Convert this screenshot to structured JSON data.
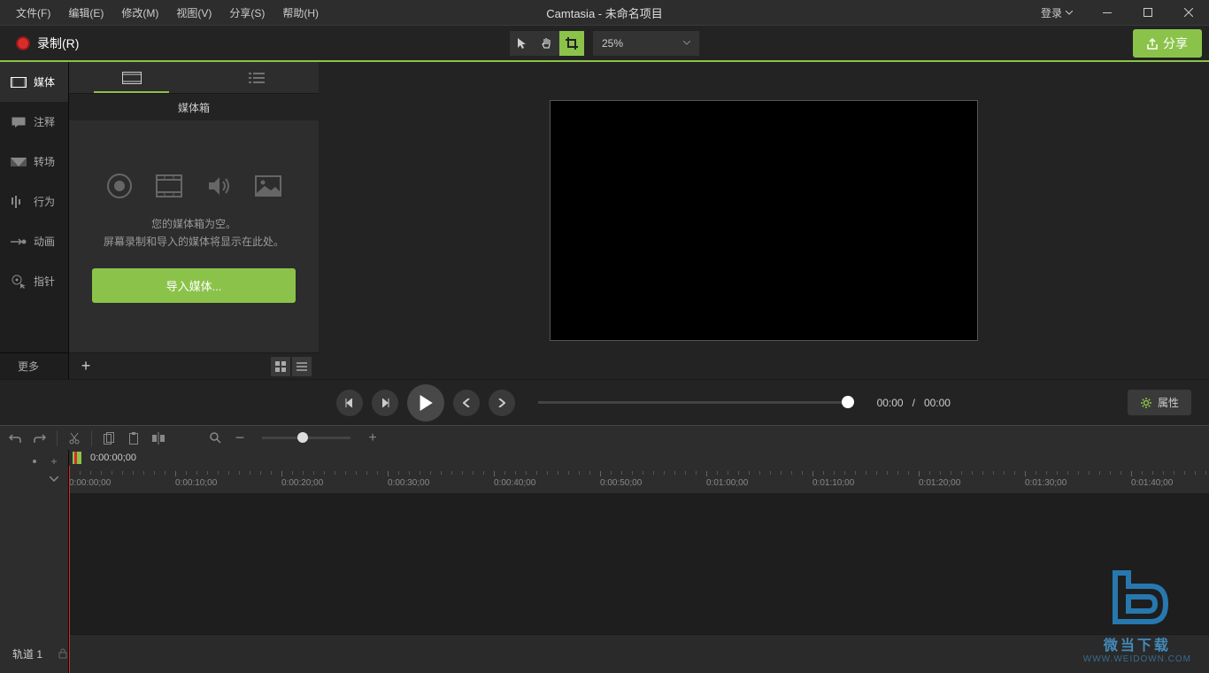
{
  "menubar": {
    "items": [
      "文件(F)",
      "编辑(E)",
      "修改(M)",
      "视图(V)",
      "分享(S)",
      "帮助(H)"
    ],
    "title": "Camtasia - 未命名项目",
    "login": "登录"
  },
  "toolbar": {
    "record": "录制(R)",
    "zoom": "25%",
    "share": "分享"
  },
  "sidebar": {
    "items": [
      {
        "label": "媒体"
      },
      {
        "label": "注释"
      },
      {
        "label": "转场"
      },
      {
        "label": "行为"
      },
      {
        "label": "动画"
      },
      {
        "label": "指针"
      }
    ],
    "more": "更多"
  },
  "panel": {
    "header": "媒体箱",
    "empty_line1": "您的媒体箱为空。",
    "empty_line2": "屏幕录制和导入的媒体将显示在此处。",
    "import_btn": "导入媒体..."
  },
  "playback": {
    "current": "00:00",
    "sep": "/",
    "total": "00:00",
    "properties": "属性"
  },
  "timeline": {
    "playhead_time": "0:00:00;00",
    "track_label": "轨道 1",
    "ticks": [
      "0:00:00;00",
      "0:00:10;00",
      "0:00:20;00",
      "0:00:30;00",
      "0:00:40;00",
      "0:00:50;00",
      "0:01:00;00",
      "0:01:10;00",
      "0:01:20;00",
      "0:01:30;00",
      "0:01:40;00"
    ]
  },
  "watermark": {
    "line1": "微当下载",
    "line2": "WWW.WEIDOWN.COM"
  }
}
